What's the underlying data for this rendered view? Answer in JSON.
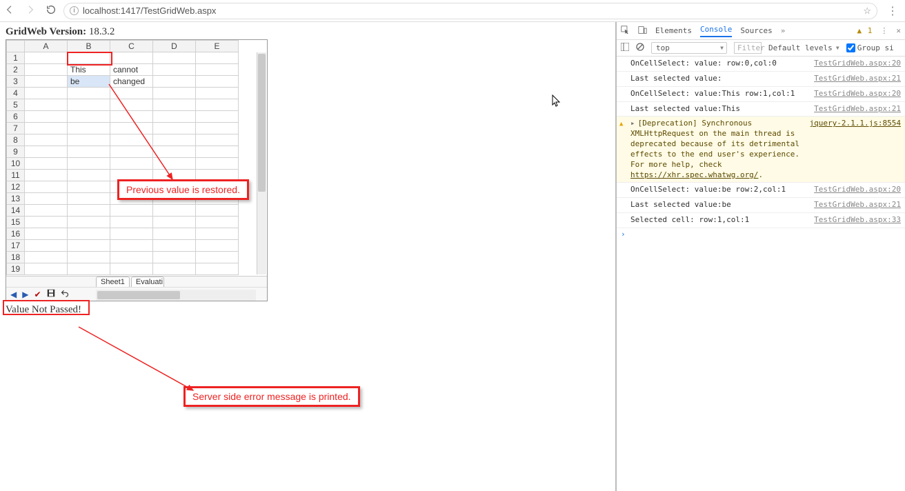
{
  "browser": {
    "url": "localhost:1417/TestGridWeb.aspx"
  },
  "page": {
    "version_label": "GridWeb Version:",
    "version_value": "18.3.2",
    "status_message": "Value Not Passed!"
  },
  "grid": {
    "columns": [
      "A",
      "B",
      "C",
      "D",
      "E"
    ],
    "row_count": 19,
    "cells": {
      "B2": "This",
      "C2": "cannot",
      "B3": "be",
      "C3": "changed"
    },
    "selected_cell": "B3",
    "tabs": [
      "Sheet1",
      "Evaluati"
    ]
  },
  "annotations": {
    "restore": "Previous value is restored.",
    "server": "Server side error message is printed."
  },
  "devtools": {
    "tabs": {
      "elements": "Elements",
      "console": "Console",
      "sources": "Sources"
    },
    "warning_count": "1",
    "context": "top",
    "filter_placeholder": "Filter",
    "levels": "Default levels",
    "group_label": "Group si",
    "logs": [
      {
        "type": "log",
        "msg": "OnCellSelect: value: row:0,col:0",
        "src": "TestGridWeb.aspx:20"
      },
      {
        "type": "log",
        "msg": "Last selected value:",
        "src": "TestGridWeb.aspx:21"
      },
      {
        "type": "log",
        "msg": "OnCellSelect: value:This row:1,col:1",
        "src": "TestGridWeb.aspx:20"
      },
      {
        "type": "log",
        "msg": "Last selected value:This",
        "src": "TestGridWeb.aspx:21"
      },
      {
        "type": "warn",
        "msg": "[Deprecation] Synchronous XMLHttpRequest on the main thread is deprecated because of its detrimental effects to the end user's experience. For more help, check ",
        "link": "https://xhr.spec.whatwg.org/",
        "src": "jquery-2.1.1.js:8554"
      },
      {
        "type": "log",
        "msg": "OnCellSelect: value:be row:2,col:1",
        "src": "TestGridWeb.aspx:20"
      },
      {
        "type": "log",
        "msg": "Last selected value:be",
        "src": "TestGridWeb.aspx:21"
      },
      {
        "type": "log",
        "msg": "Selected cell: row:1,col:1",
        "src": "TestGridWeb.aspx:33"
      }
    ]
  }
}
